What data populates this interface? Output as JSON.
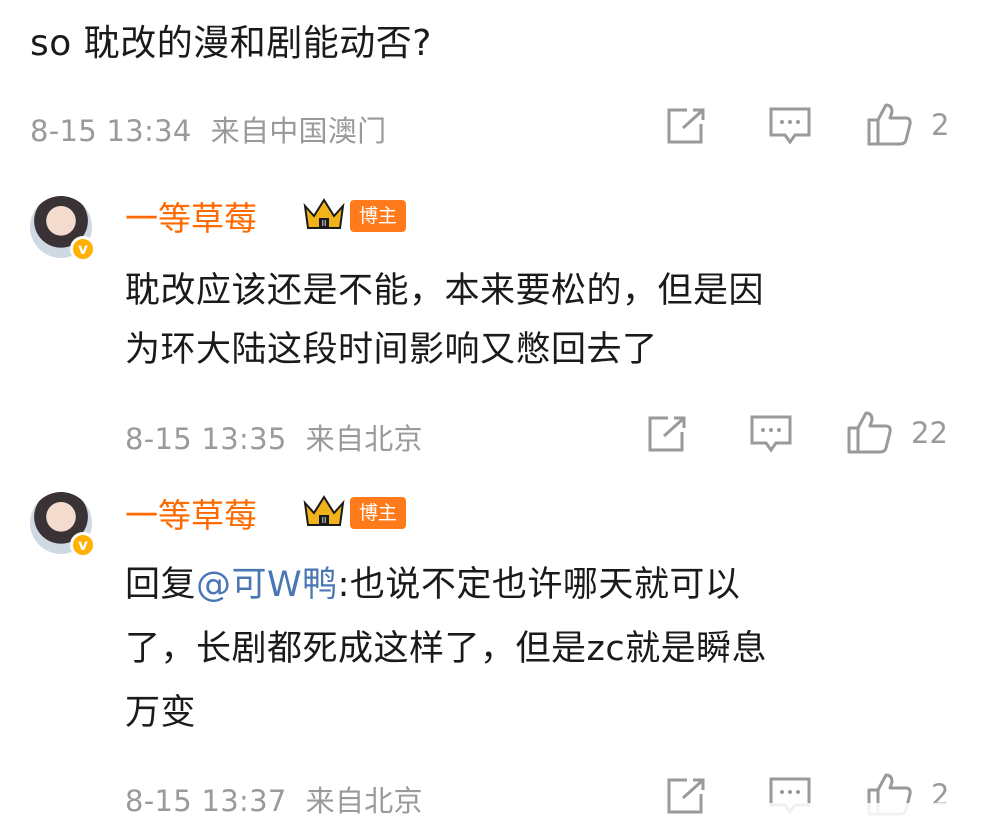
{
  "post": {
    "text": "so 耽改的漫和剧能动否?",
    "time": "8-15 13:34",
    "location": "来自中国澳门",
    "likes": "2"
  },
  "comments": [
    {
      "username": "一等草莓",
      "role_badge": "博主",
      "lines": [
        "耽改应该还是不能，本来要松的，但是因",
        "为环大陆这段时间影响又憋回去了"
      ],
      "time": "8-15 13:35",
      "location": "来自北京",
      "likes": "22"
    },
    {
      "username": "一等草莓",
      "role_badge": "博主",
      "reply_prefix": "回复",
      "mention": "@可W鸭",
      "line1_rest": ":也说不定也许哪天就可以",
      "lines": [
        "了，长剧都死成这样了，但是zc就是瞬息",
        "万变"
      ],
      "time": "8-15 13:37",
      "location": "来自北京",
      "likes": "2"
    }
  ],
  "colors": {
    "name": "#ff6a00",
    "meta": "#9a9a9a",
    "mention": "#4a77b4",
    "badge": "#ff7a1a"
  },
  "icons": [
    "share-icon",
    "comment-icon",
    "like-icon",
    "crown-badge-icon",
    "verified-icon"
  ]
}
